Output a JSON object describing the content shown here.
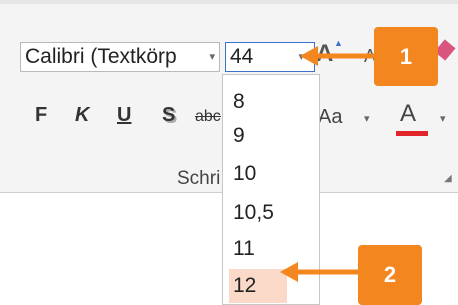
{
  "font_group": {
    "font_name": "Calibri (Textkörp",
    "font_size_value": "44",
    "grow_label": "A",
    "shrink_label": "A",
    "bold_label": "F",
    "italic_label": "K",
    "underline_label": "U",
    "shadow_label": "S",
    "strike_label": "abc",
    "change_case_label": "Aa",
    "font_color_label": "A",
    "font_color": "#e0262a",
    "group_label": "Schri",
    "dropdown_glyph": "▾"
  },
  "size_dropdown": {
    "options": [
      "8",
      "9",
      "10",
      "10,5",
      "11",
      "12"
    ],
    "selected": "12"
  },
  "annotations": {
    "callout_1": "1",
    "callout_2": "2",
    "color": "#f3861e"
  }
}
